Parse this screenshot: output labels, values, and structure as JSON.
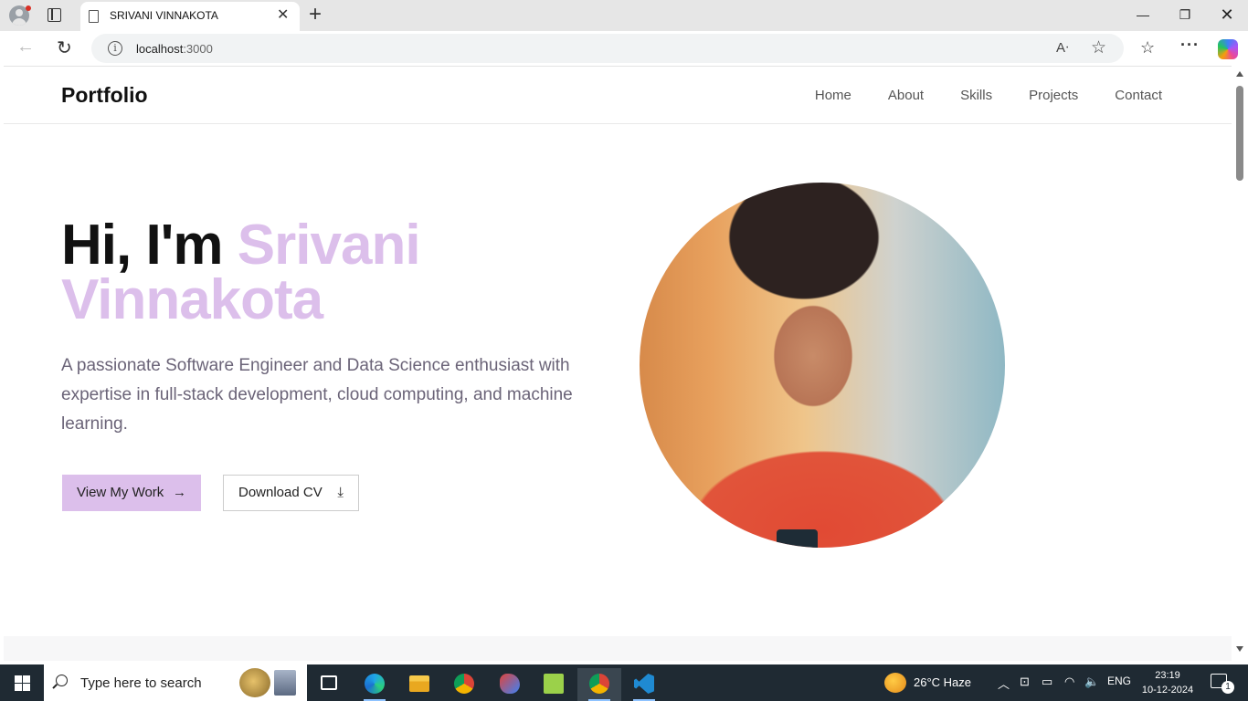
{
  "browser": {
    "tab_title": "SRIVANI VINNAKOTA",
    "url_host": "localhost",
    "url_port": ":3000"
  },
  "site": {
    "brand": "Portfolio",
    "nav": [
      {
        "label": "Home"
      },
      {
        "label": "About"
      },
      {
        "label": "Skills"
      },
      {
        "label": "Projects"
      },
      {
        "label": "Contact"
      }
    ],
    "hero": {
      "greeting": "Hi, I'm ",
      "name": "Srivani Vinnakota",
      "description": "A passionate Software Engineer and Data Science enthusiast with expertise in full-stack development, cloud computing, and machine learning.",
      "primary_button": "View My Work",
      "secondary_button": "Download CV"
    },
    "accent_color": "#dcbfeb",
    "description_color": "#6b6478"
  },
  "taskbar": {
    "search_placeholder": "Type here to search",
    "weather": "26°C  Haze",
    "language": "ENG",
    "time": "23:19",
    "date": "10-12-2024",
    "notification_count": "1"
  }
}
